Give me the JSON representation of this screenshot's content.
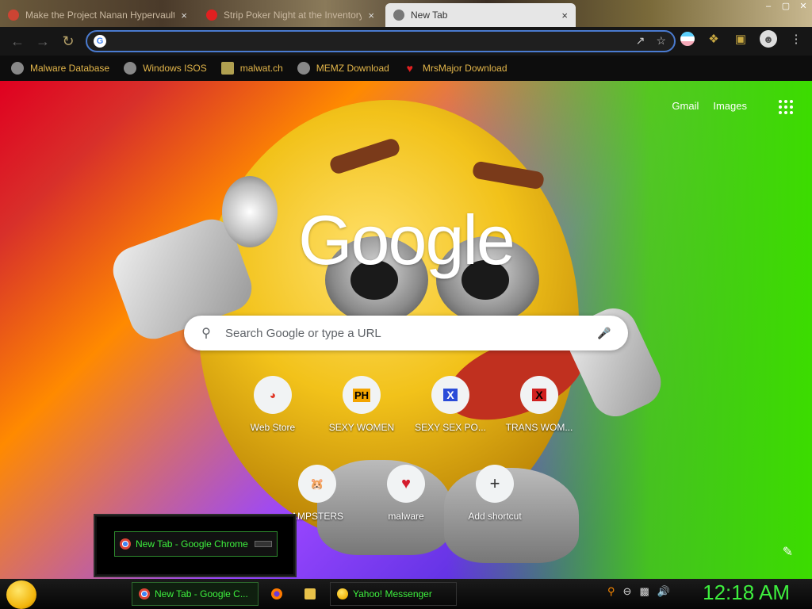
{
  "browser": {
    "tabs": [
      {
        "title": "Make the Project Nanan Hypervault!",
        "close": "×"
      },
      {
        "title": "Strip Poker Night at the Inventory",
        "close": "×"
      },
      {
        "title": "New Tab",
        "close": "×"
      }
    ],
    "window_controls": [
      "–",
      "▢",
      "✕"
    ],
    "omnibox": {
      "value": "",
      "placeholder": ""
    },
    "bookmarks": [
      {
        "label": "Malware Database"
      },
      {
        "label": "Windows ISOS"
      },
      {
        "label": "malwat.ch"
      },
      {
        "label": "MEMZ Download"
      },
      {
        "label": "MrsMajor Download"
      }
    ]
  },
  "newtab": {
    "links": {
      "gmail": "Gmail",
      "images": "Images"
    },
    "logo": "Google",
    "search_placeholder": "Search Google or type a URL",
    "shortcuts": [
      {
        "label": "Web Store",
        "icon": "web-store-icon"
      },
      {
        "label": "SEXY WOMEN",
        "icon_text": "PH"
      },
      {
        "label": "SEXY SEX PO...",
        "icon_text": "X"
      },
      {
        "label": "TRANS WOM...",
        "icon_text": "X"
      },
      {
        "label": "AMPSTERS",
        "icon": "hamster-icon"
      },
      {
        "label": "malware",
        "icon": "heart-icon"
      },
      {
        "label": "Add shortcut",
        "icon_text": "+"
      }
    ]
  },
  "thumbnail": {
    "title": "New Tab - Google Chrome"
  },
  "taskbar": {
    "tasks": [
      {
        "label": "New Tab - Google C..."
      },
      {
        "label": "Yahoo! Messenger"
      }
    ],
    "clock": "12:18 AM"
  },
  "colors": {
    "accent_green": "#3ef03e",
    "bookmark_gold": "#e3b64a",
    "omnibox_border": "#4a7bd0"
  }
}
